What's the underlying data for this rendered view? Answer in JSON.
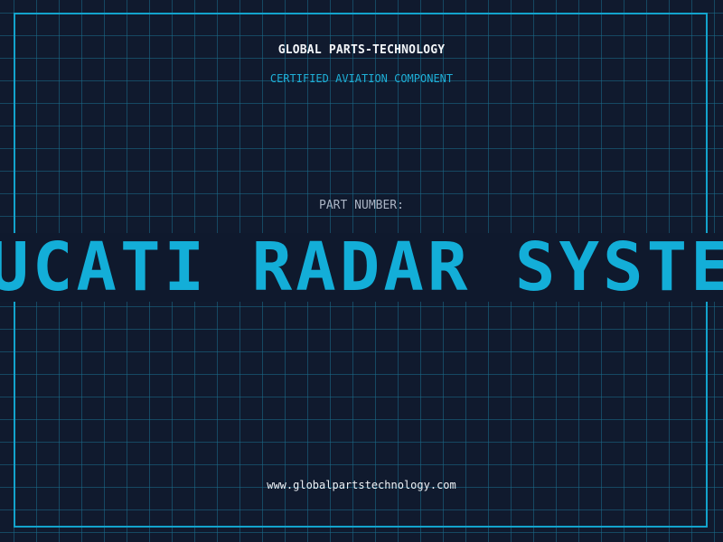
{
  "header": {
    "company": "GLOBAL PARTS-TECHNOLOGY",
    "subtitle": "CERTIFIED AVIATION COMPONENT"
  },
  "part": {
    "label": "PART NUMBER:",
    "value": "DUCATI RADAR SYSTEM"
  },
  "footer": {
    "website": "www.globalpartstechnology.com"
  },
  "colors": {
    "background": "#101a2e",
    "grid": "#1b6e8c",
    "accent": "#13aed8",
    "text": "#f2f5f8"
  }
}
